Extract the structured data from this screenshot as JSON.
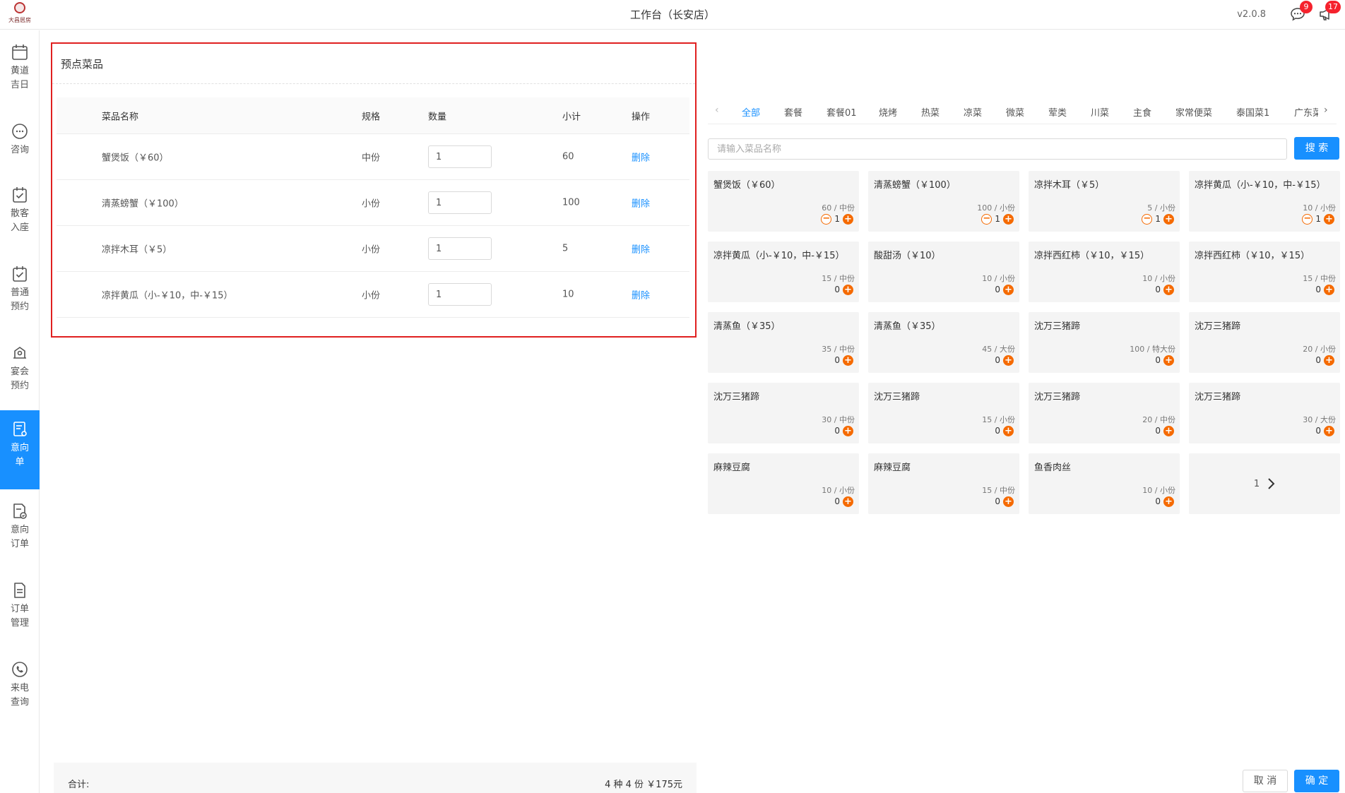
{
  "app": {
    "logo_text": "大昌居房",
    "title": "工作台（长安店）",
    "version": "v2.0.8",
    "messages_badge": "9",
    "notifications_badge": "17"
  },
  "sidebar": {
    "items": [
      {
        "label": "黄道吉日",
        "icon": "calendar-icon",
        "active": false
      },
      {
        "label": "咨询",
        "icon": "chat-icon",
        "active": false
      },
      {
        "label": "散客入座",
        "icon": "calendar-check-icon",
        "active": false
      },
      {
        "label": "普通预约",
        "icon": "calendar-check-icon",
        "active": false
      },
      {
        "label": "宴会预约",
        "icon": "banquet-icon",
        "active": false
      },
      {
        "label": "意向单",
        "icon": "intent-form-icon",
        "active": true
      },
      {
        "label": "意向订单",
        "icon": "intent-order-icon",
        "active": false
      },
      {
        "label": "订单管理",
        "icon": "document-icon",
        "active": false
      },
      {
        "label": "来电查询",
        "icon": "phone-icon",
        "active": false
      }
    ]
  },
  "preorder": {
    "title": "预点菜品",
    "columns": [
      "菜品名称",
      "规格",
      "数量",
      "小计",
      "操作"
    ],
    "rows": [
      {
        "name": "蟹煲饭（￥60）",
        "spec": "中份",
        "qty": "1",
        "subtotal": "60",
        "action": "删除"
      },
      {
        "name": "清蒸螃蟹（￥100）",
        "spec": "小份",
        "qty": "1",
        "subtotal": "100",
        "action": "删除"
      },
      {
        "name": "凉拌木耳（￥5）",
        "spec": "小份",
        "qty": "1",
        "subtotal": "5",
        "action": "删除"
      },
      {
        "name": "凉拌黄瓜（小-￥10，中-￥15）",
        "spec": "小份",
        "qty": "1",
        "subtotal": "10",
        "action": "删除"
      }
    ],
    "total_label": "合计:",
    "total_value": "4 种 4 份 ￥175元"
  },
  "menu": {
    "categories": [
      "全部",
      "套餐",
      "套餐01",
      "烧烤",
      "热菜",
      "凉菜",
      "微菜",
      "荤类",
      "川菜",
      "主食",
      "家常便菜",
      "泰国菜1",
      "广东菜"
    ],
    "active_category": "全部",
    "search_placeholder": "请输入菜品名称",
    "search_button": "搜 索",
    "dishes": [
      {
        "name": "蟹煲饭（￥60）",
        "spec": "60 / 中份",
        "qty": "1",
        "has_minus": true
      },
      {
        "name": "清蒸螃蟹（￥100）",
        "spec": "100 / 小份",
        "qty": "1",
        "has_minus": true
      },
      {
        "name": "凉拌木耳（￥5）",
        "spec": "5 / 小份",
        "qty": "1",
        "has_minus": true
      },
      {
        "name": "凉拌黄瓜（小-￥10，中-￥15）",
        "spec": "10 / 小份",
        "qty": "1",
        "has_minus": true
      },
      {
        "name": "凉拌黄瓜（小-￥10，中-￥15）",
        "spec": "15 / 中份",
        "qty": "0",
        "has_minus": false
      },
      {
        "name": "酸甜汤（￥10）",
        "spec": "10 / 小份",
        "qty": "0",
        "has_minus": false
      },
      {
        "name": "凉拌西红柿（￥10，￥15）",
        "spec": "10 / 小份",
        "qty": "0",
        "has_minus": false
      },
      {
        "name": "凉拌西红柿（￥10，￥15）",
        "spec": "15 / 中份",
        "qty": "0",
        "has_minus": false
      },
      {
        "name": "清蒸鱼（￥35）",
        "spec": "35 / 中份",
        "qty": "0",
        "has_minus": false
      },
      {
        "name": "清蒸鱼（￥35）",
        "spec": "45 / 大份",
        "qty": "0",
        "has_minus": false
      },
      {
        "name": "沈万三猪蹄",
        "spec": "100 / 特大份",
        "qty": "0",
        "has_minus": false
      },
      {
        "name": "沈万三猪蹄",
        "spec": "20 / 小份",
        "qty": "0",
        "has_minus": false
      },
      {
        "name": "沈万三猪蹄",
        "spec": "30 / 中份",
        "qty": "0",
        "has_minus": false
      },
      {
        "name": "沈万三猪蹄",
        "spec": "15 / 小份",
        "qty": "0",
        "has_minus": false
      },
      {
        "name": "沈万三猪蹄",
        "spec": "20 / 中份",
        "qty": "0",
        "has_minus": false
      },
      {
        "name": "沈万三猪蹄",
        "spec": "30 / 大份",
        "qty": "0",
        "has_minus": false
      },
      {
        "name": "麻辣豆腐",
        "spec": "10 / 小份",
        "qty": "0",
        "has_minus": false
      },
      {
        "name": "麻辣豆腐",
        "spec": "15 / 中份",
        "qty": "0",
        "has_minus": false
      },
      {
        "name": "鱼香肉丝",
        "spec": "10 / 小份",
        "qty": "0",
        "has_minus": false
      }
    ],
    "page": "1",
    "cancel_button": "取 消",
    "confirm_button": "确 定"
  },
  "colors": {
    "primary": "#1890ff",
    "danger": "#f5222d",
    "highlight_border": "#e02020",
    "plus_button": "#f56a00"
  }
}
